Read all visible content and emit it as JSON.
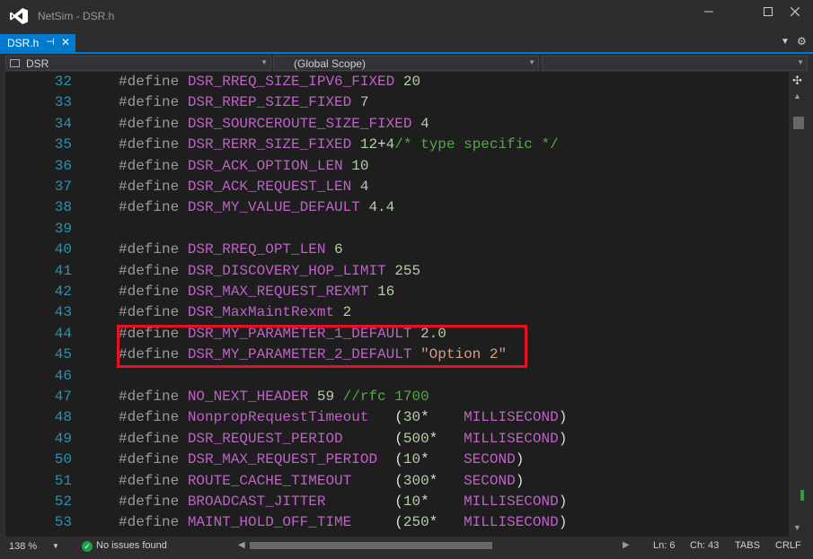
{
  "window": {
    "title": "NetSim - DSR.h",
    "minimize_icon": "minimize-icon",
    "maximize_icon": "maximize-icon",
    "close_icon": "close-icon"
  },
  "tab": {
    "title": "DSR.h",
    "pin_glyph": "⊣",
    "close_glyph": "✕"
  },
  "navbar": {
    "file": "DSR",
    "scope": "(Global Scope)",
    "member": ""
  },
  "code_lines": [
    {
      "n": "32",
      "tokens": [
        [
          "kw",
          "#define "
        ],
        [
          "mac",
          "DSR_RREQ_SIZE_IPV6_FIXED"
        ],
        [
          "id",
          " "
        ],
        [
          "num",
          "20"
        ]
      ]
    },
    {
      "n": "33",
      "tokens": [
        [
          "kw",
          "#define "
        ],
        [
          "mac",
          "DSR_RREP_SIZE_FIXED"
        ],
        [
          "id",
          " "
        ],
        [
          "num",
          "7"
        ]
      ]
    },
    {
      "n": "34",
      "tokens": [
        [
          "kw",
          "#define "
        ],
        [
          "mac",
          "DSR_SOURCEROUTE_SIZE_FIXED"
        ],
        [
          "id",
          " "
        ],
        [
          "num",
          "4"
        ]
      ]
    },
    {
      "n": "35",
      "tokens": [
        [
          "kw",
          "#define "
        ],
        [
          "mac",
          "DSR_RERR_SIZE_FIXED"
        ],
        [
          "id",
          " "
        ],
        [
          "num",
          "12"
        ],
        [
          "id",
          "+"
        ],
        [
          "num",
          "4"
        ],
        [
          "cm",
          "/* type specific */"
        ]
      ]
    },
    {
      "n": "36",
      "tokens": [
        [
          "kw",
          "#define "
        ],
        [
          "mac",
          "DSR_ACK_OPTION_LEN"
        ],
        [
          "id",
          " "
        ],
        [
          "num",
          "10"
        ]
      ]
    },
    {
      "n": "37",
      "tokens": [
        [
          "kw",
          "#define "
        ],
        [
          "mac",
          "DSR_ACK_REQUEST_LEN"
        ],
        [
          "id",
          " "
        ],
        [
          "num",
          "4"
        ]
      ]
    },
    {
      "n": "38",
      "tokens": [
        [
          "kw",
          "#define "
        ],
        [
          "mac",
          "DSR_MY_VALUE_DEFAULT"
        ],
        [
          "id",
          " "
        ],
        [
          "num",
          "4.4"
        ]
      ]
    },
    {
      "n": "39",
      "tokens": []
    },
    {
      "n": "40",
      "tokens": [
        [
          "kw",
          "#define "
        ],
        [
          "mac",
          "DSR_RREQ_OPT_LEN"
        ],
        [
          "id",
          " "
        ],
        [
          "num",
          "6"
        ]
      ]
    },
    {
      "n": "41",
      "tokens": [
        [
          "kw",
          "#define "
        ],
        [
          "mac",
          "DSR_DISCOVERY_HOP_LIMIT"
        ],
        [
          "id",
          " "
        ],
        [
          "num",
          "255"
        ]
      ]
    },
    {
      "n": "42",
      "tokens": [
        [
          "kw",
          "#define "
        ],
        [
          "mac",
          "DSR_MAX_REQUEST_REXMT"
        ],
        [
          "id",
          " "
        ],
        [
          "num",
          "16"
        ]
      ]
    },
    {
      "n": "43",
      "tokens": [
        [
          "kw",
          "#define "
        ],
        [
          "mac",
          "DSR_MaxMaintRexmt"
        ],
        [
          "id",
          " "
        ],
        [
          "num",
          "2"
        ]
      ]
    },
    {
      "n": "44",
      "tokens": [
        [
          "kw",
          "#define "
        ],
        [
          "mac",
          "DSR_MY_PARAMETER_1_DEFAULT"
        ],
        [
          "id",
          " "
        ],
        [
          "num",
          "2.0"
        ]
      ]
    },
    {
      "n": "45",
      "tokens": [
        [
          "kw",
          "#define "
        ],
        [
          "mac",
          "DSR_MY_PARAMETER_2_DEFAULT"
        ],
        [
          "id",
          " "
        ],
        [
          "str",
          "\"Option 2\""
        ]
      ]
    },
    {
      "n": "46",
      "tokens": []
    },
    {
      "n": "47",
      "tokens": [
        [
          "kw",
          "#define "
        ],
        [
          "mac",
          "NO_NEXT_HEADER"
        ],
        [
          "id",
          " "
        ],
        [
          "num",
          "59"
        ],
        [
          "id",
          " "
        ],
        [
          "cm",
          "//rfc 1700"
        ]
      ]
    },
    {
      "n": "48",
      "tokens": [
        [
          "kw",
          "#define "
        ],
        [
          "mac",
          "NonpropRequestTimeout"
        ],
        [
          "id",
          "   ("
        ],
        [
          "num",
          "30"
        ],
        [
          "id",
          "*    "
        ],
        [
          "mac",
          "MILLISECOND"
        ],
        [
          "id",
          ")"
        ]
      ]
    },
    {
      "n": "49",
      "tokens": [
        [
          "kw",
          "#define "
        ],
        [
          "mac",
          "DSR_REQUEST_PERIOD"
        ],
        [
          "id",
          "      ("
        ],
        [
          "num",
          "500"
        ],
        [
          "id",
          "*   "
        ],
        [
          "mac",
          "MILLISECOND"
        ],
        [
          "id",
          ")"
        ]
      ]
    },
    {
      "n": "50",
      "tokens": [
        [
          "kw",
          "#define "
        ],
        [
          "mac",
          "DSR_MAX_REQUEST_PERIOD"
        ],
        [
          "id",
          "  ("
        ],
        [
          "num",
          "10"
        ],
        [
          "id",
          "*    "
        ],
        [
          "mac",
          "SECOND"
        ],
        [
          "id",
          ")"
        ]
      ]
    },
    {
      "n": "51",
      "tokens": [
        [
          "kw",
          "#define "
        ],
        [
          "mac",
          "ROUTE_CACHE_TIMEOUT"
        ],
        [
          "id",
          "     ("
        ],
        [
          "num",
          "300"
        ],
        [
          "id",
          "*   "
        ],
        [
          "mac",
          "SECOND"
        ],
        [
          "id",
          ")"
        ]
      ]
    },
    {
      "n": "52",
      "tokens": [
        [
          "kw",
          "#define "
        ],
        [
          "mac",
          "BROADCAST_JITTER"
        ],
        [
          "id",
          "        ("
        ],
        [
          "num",
          "10"
        ],
        [
          "id",
          "*    "
        ],
        [
          "mac",
          "MILLISECOND"
        ],
        [
          "id",
          ")"
        ]
      ]
    },
    {
      "n": "53",
      "tokens": [
        [
          "kw",
          "#define "
        ],
        [
          "mac",
          "MAINT_HOLD_OFF_TIME"
        ],
        [
          "id",
          "     ("
        ],
        [
          "num",
          "250"
        ],
        [
          "id",
          "*   "
        ],
        [
          "mac",
          "MILLISECOND"
        ],
        [
          "id",
          ")"
        ]
      ]
    }
  ],
  "status": {
    "zoom": "138 %",
    "issues": "No issues found",
    "line": "Ln: 6",
    "col": "Ch: 43",
    "indent": "TABS",
    "eol": "CRLF"
  },
  "colors": {
    "accent": "#007acc",
    "highlight_box": "#e81123",
    "line_number": "#2b91af",
    "macro": "#bd63c5",
    "number": "#b5cea8",
    "comment": "#57a64a",
    "string": "#d69d85"
  }
}
